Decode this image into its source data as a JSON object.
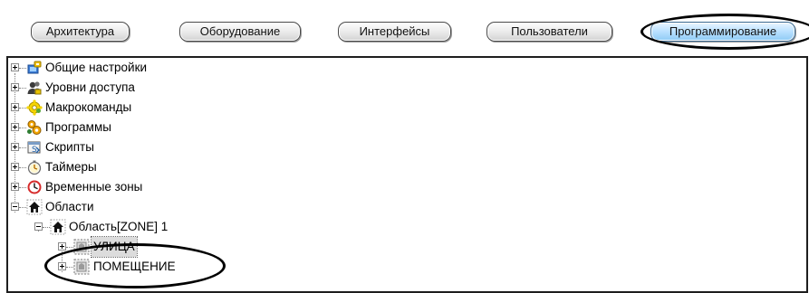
{
  "tabs": [
    {
      "label": "Архитектура"
    },
    {
      "label": "Оборудование"
    },
    {
      "label": "Интерфейсы"
    },
    {
      "label": "Пользователи"
    },
    {
      "label": "Программирование",
      "active": true
    }
  ],
  "tree": {
    "items": [
      {
        "label": "Общие настройки",
        "icon": "settings-icon"
      },
      {
        "label": "Уровни доступа",
        "icon": "access-levels-icon"
      },
      {
        "label": "Макрокоманды",
        "icon": "macro-icon"
      },
      {
        "label": "Программы",
        "icon": "programs-icon"
      },
      {
        "label": "Скрипты",
        "icon": "scripts-icon"
      },
      {
        "label": "Таймеры",
        "icon": "timer-icon"
      },
      {
        "label": "Временные зоны",
        "icon": "clock-icon"
      },
      {
        "label": "Области",
        "icon": "house-icon"
      },
      {
        "label": "Область[ZONE] 1",
        "icon": "house-icon"
      },
      {
        "label": "УЛИЦА",
        "icon": "zone-icon"
      },
      {
        "label": "ПОМЕЩЕНИЕ",
        "icon": "zone-icon"
      }
    ]
  },
  "colors": {
    "active_tab": "#b9e0ff",
    "annotation_ring": "#000000",
    "clock_red": "#d62b2b"
  }
}
